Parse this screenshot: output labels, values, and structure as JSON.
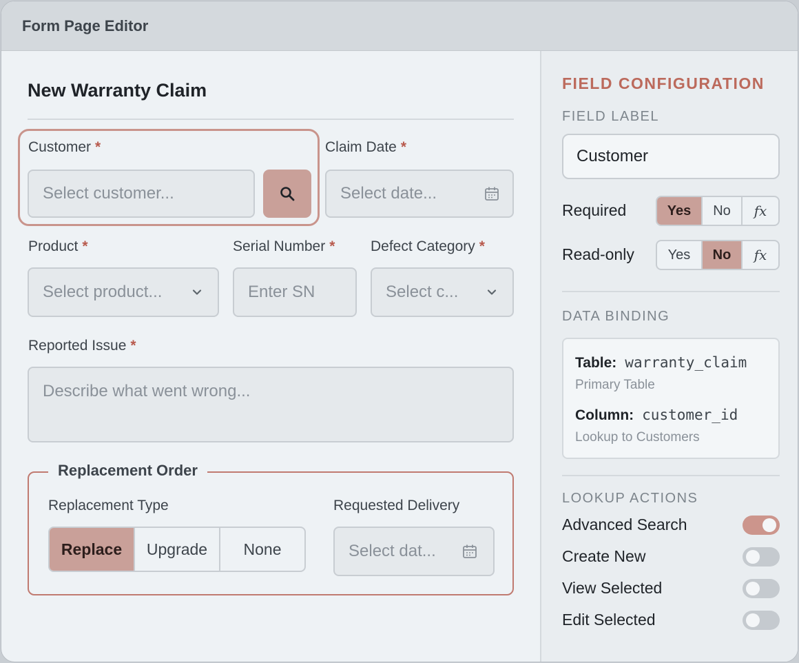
{
  "window": {
    "title": "Form Page Editor"
  },
  "form": {
    "title": "New Warranty Claim",
    "required_mark": "*",
    "customer": {
      "label": "Customer",
      "placeholder": "Select customer..."
    },
    "claim_date": {
      "label": "Claim Date",
      "placeholder": "Select date..."
    },
    "product": {
      "label": "Product",
      "placeholder": "Select product..."
    },
    "serial_number": {
      "label": "Serial Number",
      "placeholder": "Enter SN"
    },
    "defect_category": {
      "label": "Defect Category",
      "placeholder": "Select c..."
    },
    "reported_issue": {
      "label": "Reported Issue",
      "placeholder": "Describe what went wrong..."
    },
    "replacement_order": {
      "legend": "Replacement Order",
      "type_label": "Replacement Type",
      "type_options": [
        "Replace",
        "Upgrade",
        "None"
      ],
      "type_selected": "Replace",
      "delivery_label": "Requested Delivery",
      "delivery_placeholder": "Select dat..."
    }
  },
  "config": {
    "title": "FIELD CONFIGURATION",
    "field_label_heading": "FIELD LABEL",
    "field_label_value": "Customer",
    "required": {
      "label": "Required",
      "options": [
        "Yes",
        "No",
        "fx"
      ],
      "selected": "Yes"
    },
    "read_only": {
      "label": "Read-only",
      "options": [
        "Yes",
        "No",
        "fx"
      ],
      "selected": "No"
    },
    "data_binding": {
      "heading": "DATA BINDING",
      "table_key": "Table:",
      "table_value": "warranty_claim",
      "table_sub": "Primary Table",
      "column_key": "Column:",
      "column_value": "customer_id",
      "column_sub": "Lookup to Customers"
    },
    "lookup_actions": {
      "heading": "LOOKUP ACTIONS",
      "items": [
        {
          "label": "Advanced Search",
          "enabled": true
        },
        {
          "label": "Create New",
          "enabled": false
        },
        {
          "label": "View Selected",
          "enabled": false
        },
        {
          "label": "Edit Selected",
          "enabled": false
        }
      ]
    }
  },
  "colors": {
    "accent": "#c9a099",
    "accent_text": "#bc6a5c",
    "required_mark": "#b85a4d"
  },
  "icons": {
    "search": "search-icon",
    "calendar": "calendar-icon",
    "chevron": "chevron-down-icon"
  }
}
